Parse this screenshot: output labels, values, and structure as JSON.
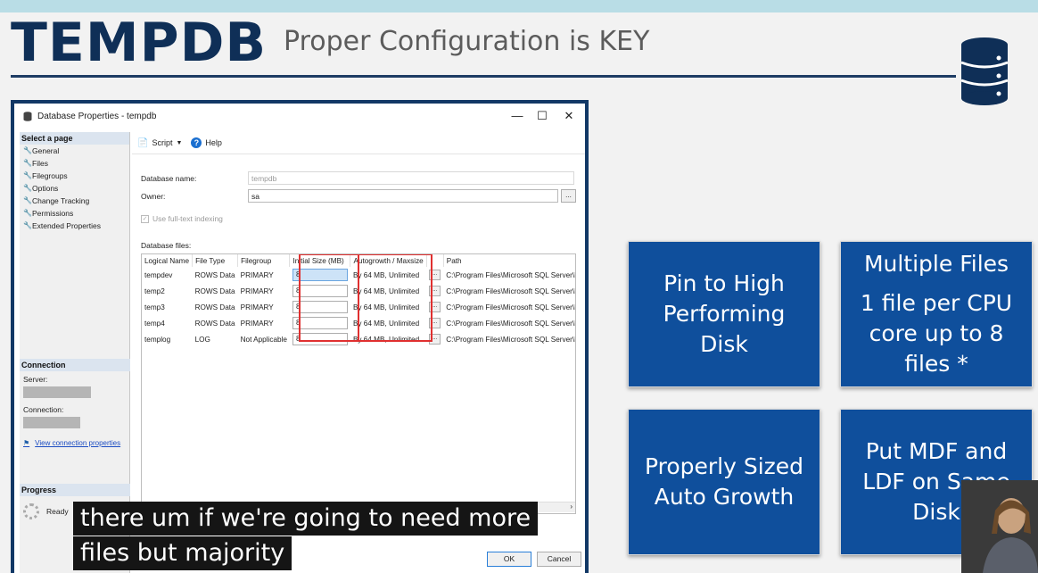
{
  "slide": {
    "title": "TEMPDB",
    "subtitle": "Proper Configuration is KEY",
    "db_icon": "database-icon"
  },
  "dialog": {
    "window_title": "Database Properties - tempdb",
    "window_controls": {
      "minimize": "—",
      "maximize": "☐",
      "close": "✕"
    },
    "select_page_header": "Select a page",
    "pages": [
      "General",
      "Files",
      "Filegroups",
      "Options",
      "Change Tracking",
      "Permissions",
      "Extended Properties"
    ],
    "toolbar": {
      "script_label": "Script",
      "help_label": "Help"
    },
    "form": {
      "database_name_label": "Database name:",
      "database_name_value": "tempdb",
      "owner_label": "Owner:",
      "owner_value": "sa",
      "fulltext_label": "Use full-text indexing",
      "files_label": "Database files:",
      "browse_label": "..."
    },
    "columns": [
      "Logical Name",
      "File Type",
      "Filegroup",
      "Initial Size (MB)",
      "Autogrowth / Maxsize",
      "",
      "Path"
    ],
    "rows": [
      {
        "name": "tempdev",
        "type": "ROWS Data",
        "filegroup": "PRIMARY",
        "size": "8",
        "growth": "By 64 MB, Unlimited",
        "path": "C:\\Program Files\\Microsoft SQL Server\\M"
      },
      {
        "name": "temp2",
        "type": "ROWS Data",
        "filegroup": "PRIMARY",
        "size": "8",
        "growth": "By 64 MB, Unlimited",
        "path": "C:\\Program Files\\Microsoft SQL Server\\M"
      },
      {
        "name": "temp3",
        "type": "ROWS Data",
        "filegroup": "PRIMARY",
        "size": "8",
        "growth": "By 64 MB, Unlimited",
        "path": "C:\\Program Files\\Microsoft SQL Server\\M"
      },
      {
        "name": "temp4",
        "type": "ROWS Data",
        "filegroup": "PRIMARY",
        "size": "8",
        "growth": "By 64 MB, Unlimited",
        "path": "C:\\Program Files\\Microsoft SQL Server\\M"
      },
      {
        "name": "templog",
        "type": "LOG",
        "filegroup": "Not Applicable",
        "size": "8",
        "growth": "By 64 MB, Unlimited",
        "path": "C:\\Program Files\\Microsoft SQL Server\\M"
      }
    ],
    "connection": {
      "header": "Connection",
      "server_label": "Server:",
      "connection_label": "Connection:",
      "view_link": "View connection properties"
    },
    "progress": {
      "header": "Progress",
      "status": "Ready"
    },
    "buttons": {
      "ok": "OK",
      "cancel": "Cancel"
    }
  },
  "tiles": [
    {
      "text": "Pin to High\nPerforming\nDisk"
    },
    {
      "title": "Multiple Files",
      "text": "1 file per CPU\ncore up to 8\nfiles *"
    },
    {
      "text": "Properly Sized\nAuto Growth"
    },
    {
      "text": "Put MDF and\nLDF on Same\nDisk"
    }
  ],
  "caption": {
    "line1": "there um if we're going to need more",
    "line2": "files but majority"
  },
  "colors": {
    "navy": "#0f2f57",
    "tile_blue": "#0f4f9c",
    "highlight_red": "#e03030"
  }
}
